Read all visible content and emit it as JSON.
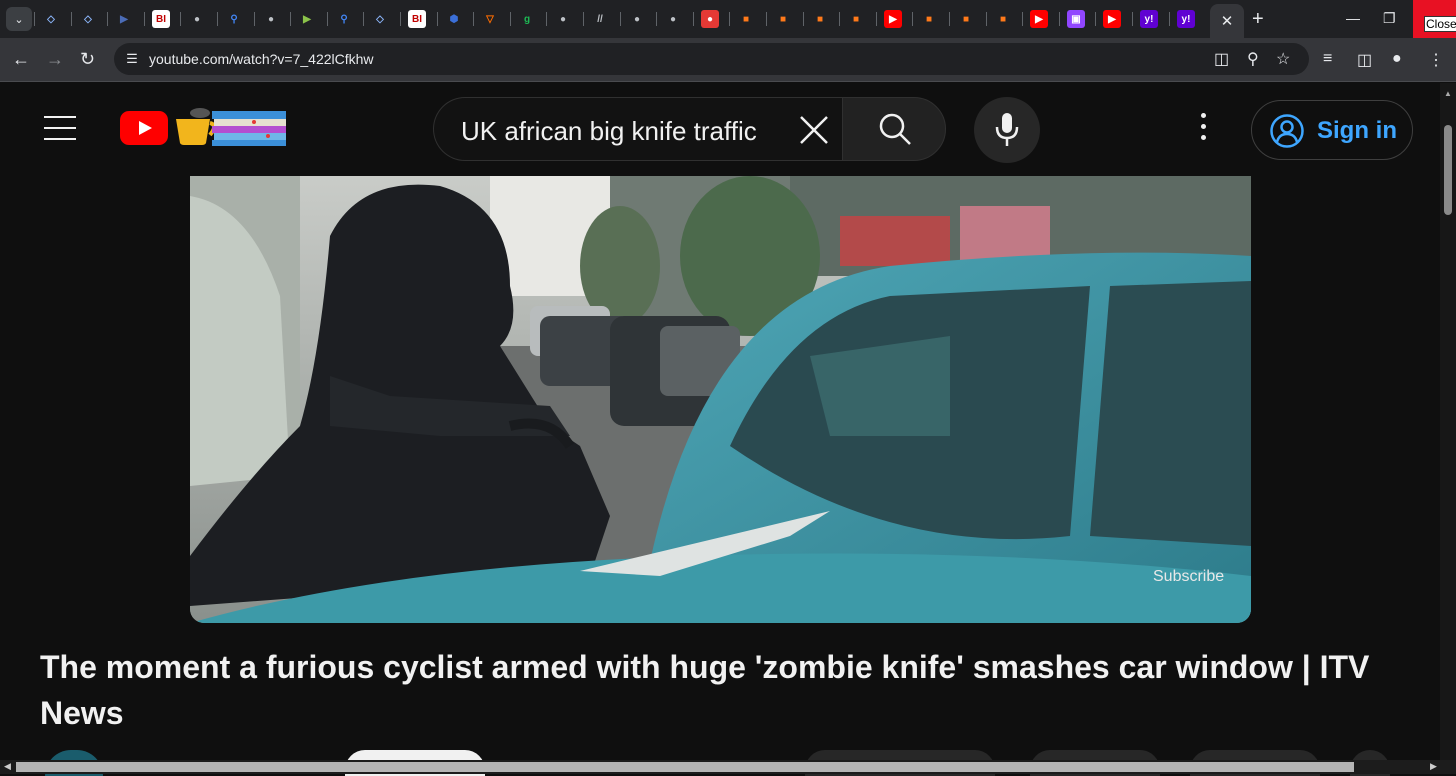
{
  "browser": {
    "url": "youtube.com/watch?v=7_422lCfkhw",
    "close_label": "Close",
    "tab_favicons": [
      {
        "glyph": "◇",
        "color": "#8ab4f8",
        "bg": "transparent"
      },
      {
        "glyph": "◇",
        "color": "#8ab4f8",
        "bg": "transparent"
      },
      {
        "glyph": "▶",
        "color": "#4b6cb7",
        "bg": "transparent"
      },
      {
        "glyph": "BI",
        "color": "#c00000",
        "bg": "#ffffff"
      },
      {
        "glyph": "●",
        "color": "#bdc1c6",
        "bg": "transparent"
      },
      {
        "glyph": "⚲",
        "color": "#4285f4",
        "bg": "transparent"
      },
      {
        "glyph": "●",
        "color": "#bdc1c6",
        "bg": "transparent"
      },
      {
        "glyph": "▶",
        "color": "#8bc34a",
        "bg": "transparent"
      },
      {
        "glyph": "⚲",
        "color": "#4285f4",
        "bg": "transparent"
      },
      {
        "glyph": "◇",
        "color": "#8ab4f8",
        "bg": "transparent"
      },
      {
        "glyph": "BI",
        "color": "#c00000",
        "bg": "#ffffff"
      },
      {
        "glyph": "⬢",
        "color": "#3b6fd8",
        "bg": "transparent"
      },
      {
        "glyph": "▽",
        "color": "#ff6d00",
        "bg": "transparent"
      },
      {
        "glyph": "g",
        "color": "#1db954",
        "bg": "transparent"
      },
      {
        "glyph": "●",
        "color": "#bdc1c6",
        "bg": "transparent"
      },
      {
        "glyph": "//",
        "color": "#bdc1c6",
        "bg": "transparent"
      },
      {
        "glyph": "●",
        "color": "#bdc1c6",
        "bg": "transparent"
      },
      {
        "glyph": "●",
        "color": "#bdc1c6",
        "bg": "transparent"
      },
      {
        "glyph": "●",
        "color": "#ffffff",
        "bg": "#e53935"
      },
      {
        "glyph": "■",
        "color": "#ff7a1a",
        "bg": "transparent"
      },
      {
        "glyph": "■",
        "color": "#ff7a1a",
        "bg": "transparent"
      },
      {
        "glyph": "■",
        "color": "#ff7a1a",
        "bg": "transparent"
      },
      {
        "glyph": "■",
        "color": "#ff7a1a",
        "bg": "transparent"
      },
      {
        "glyph": "▶",
        "color": "#ffffff",
        "bg": "#ff0000"
      },
      {
        "glyph": "■",
        "color": "#ff7a1a",
        "bg": "transparent"
      },
      {
        "glyph": "■",
        "color": "#ff7a1a",
        "bg": "transparent"
      },
      {
        "glyph": "■",
        "color": "#ff7a1a",
        "bg": "transparent"
      },
      {
        "glyph": "▶",
        "color": "#ffffff",
        "bg": "#ff0000"
      },
      {
        "glyph": "▣",
        "color": "#ffffff",
        "bg": "#9146ff"
      },
      {
        "glyph": "▶",
        "color": "#ffffff",
        "bg": "#ff0000"
      },
      {
        "glyph": "y!",
        "color": "#ffffff",
        "bg": "#6001d2"
      },
      {
        "glyph": "y!",
        "color": "#ffffff",
        "bg": "#6001d2"
      }
    ]
  },
  "masthead": {
    "search_query": "UK african big knife traffic",
    "signin_label": "Sign in"
  },
  "player": {
    "overlay_text": "Subscribe"
  },
  "video": {
    "title": "The moment a furious cyclist armed with huge 'zombie knife' smashes car window | ITV News"
  },
  "colors": {
    "accent": "#3ea6ff",
    "youtube_red": "#ff0000",
    "background": "#0f0f0f"
  }
}
